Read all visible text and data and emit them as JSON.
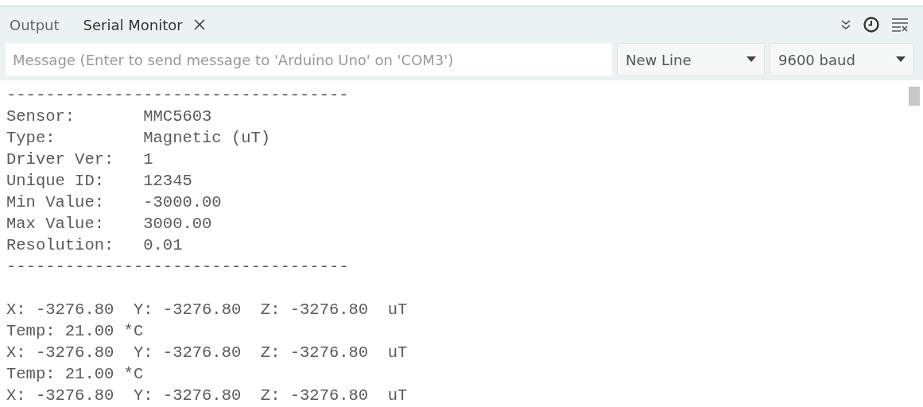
{
  "tabs": [
    {
      "label": "Output",
      "selected": false,
      "closable": false
    },
    {
      "label": "Serial Monitor",
      "selected": true,
      "closable": true
    }
  ],
  "message": {
    "placeholder": "Message (Enter to send message to 'Arduino Uno' on 'COM3')"
  },
  "line_ending": {
    "value": "New Line"
  },
  "baud_rate": {
    "value": "9600 baud"
  },
  "output_lines": [
    {
      "kind": "text",
      "text": "-----------------------------------"
    },
    {
      "kind": "text",
      "text": "Sensor:       MMC5603"
    },
    {
      "kind": "text",
      "text": "Type:         Magnetic (uT)"
    },
    {
      "kind": "text",
      "text": "Driver Ver:   1"
    },
    {
      "kind": "text",
      "text": "Unique ID:    12345"
    },
    {
      "kind": "text",
      "text": "Min Value:    -3000.00"
    },
    {
      "kind": "text",
      "text": "Max Value:    3000.00"
    },
    {
      "kind": "text",
      "text": "Resolution:   0.01"
    },
    {
      "kind": "text",
      "text": "-----------------------------------"
    },
    {
      "kind": "blank"
    },
    {
      "kind": "text",
      "text": "X: -3276.80  Y: -3276.80  Z: -3276.80  uT"
    },
    {
      "kind": "text",
      "text": "Temp: 21.00 *C"
    },
    {
      "kind": "text",
      "text": "X: -3276.80  Y: -3276.80  Z: -3276.80  uT"
    },
    {
      "kind": "text",
      "text": "Temp: 21.00 *C"
    },
    {
      "kind": "text",
      "text": "X: -3276.80  Y: -3276.80  Z: -3276.80  uT"
    }
  ]
}
